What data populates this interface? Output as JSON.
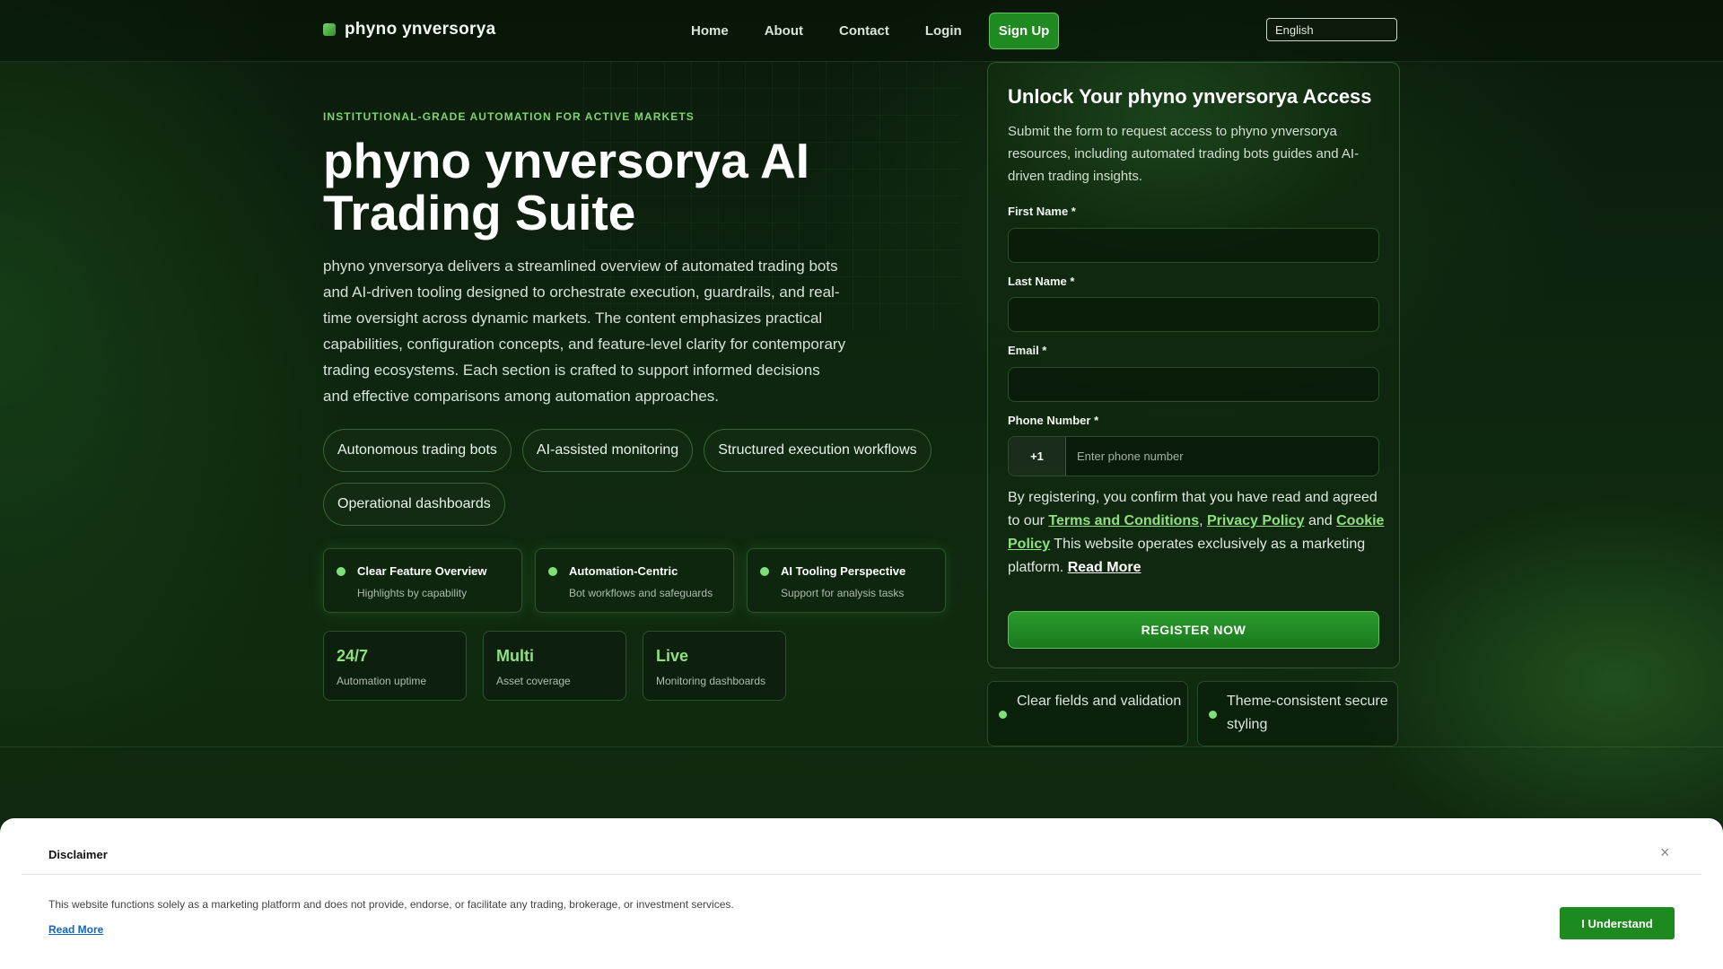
{
  "brand": {
    "name": "phyno ynversorya",
    "accent": "#7fd46e",
    "button": "#1f8a22"
  },
  "nav": {
    "links": [
      "Home",
      "About",
      "Contact",
      "Login"
    ],
    "signup": "Sign Up",
    "language": "English"
  },
  "hero": {
    "eyebrow": "INSTITUTIONAL-GRADE AUTOMATION FOR ACTIVE MARKETS",
    "title": "phyno ynversorya AI Trading Suite",
    "description": "phyno ynversorya delivers a streamlined overview of automated trading bots and AI-driven tooling designed to orchestrate execution, guardrails, and real-time oversight across dynamic markets. The content emphasizes practical capabilities, configuration concepts, and feature-level clarity for contemporary trading ecosystems. Each section is crafted to support informed decisions and effective comparisons among automation approaches.",
    "tags": [
      "Autonomous trading bots",
      "AI-assisted monitoring",
      "Structured execution workflows",
      "Operational dashboards"
    ],
    "features": [
      {
        "title": "Clear Feature Overview",
        "sub": "Highlights by capability"
      },
      {
        "title": "Automation-Centric",
        "sub": "Bot workflows and safeguards"
      },
      {
        "title": "AI Tooling Perspective",
        "sub": "Support for analysis tasks"
      }
    ],
    "stats": [
      {
        "value": "24/7",
        "label": "Automation uptime"
      },
      {
        "value": "Multi",
        "label": "Asset coverage"
      },
      {
        "value": "Live",
        "label": "Monitoring dashboards"
      }
    ]
  },
  "form": {
    "title": "Unlock Your phyno ynversorya Access",
    "description": "Submit the form to request access to phyno ynversorya resources, including automated trading bots guides and AI-driven trading insights.",
    "first_name_label": "First Name *",
    "last_name_label": "Last Name *",
    "email_label": "Email *",
    "phone_label": "Phone Number *",
    "country_code": "+1",
    "phone_placeholder": "Enter phone number",
    "consent_prefix": "By registering, you confirm that you have read and agreed to our",
    "terms": "Terms and Conditions",
    "privacy": "Privacy Policy",
    "and": "and",
    "cookie": "Cookie Policy",
    "consent_suffix": "This website operates exclusively as a marketing platform.",
    "read_more": "Read More",
    "submit": "REGISTER NOW"
  },
  "form_notes": [
    "Clear fields and validation",
    "Theme-consistent secure styling"
  ],
  "disclaimer": {
    "title": "Disclaimer",
    "close": "×",
    "text": "This website functions solely as a marketing platform and does not provide, endorse, or facilitate any trading, brokerage, or investment services.",
    "read_more": "Read More",
    "button": "I Understand"
  }
}
